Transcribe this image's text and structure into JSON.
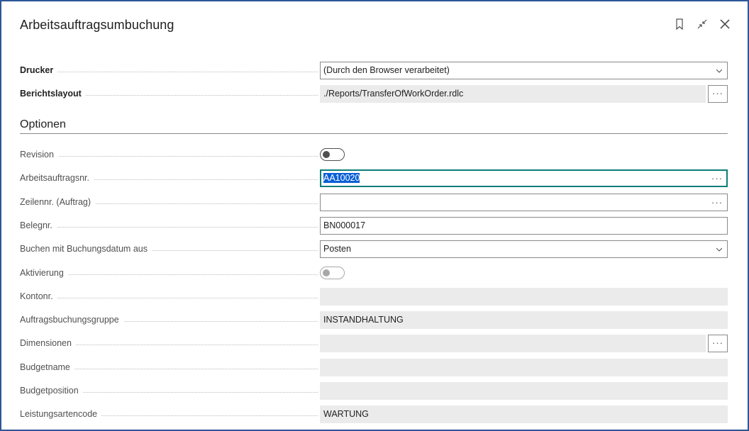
{
  "dialog": {
    "title": "Arbeitsauftragsumbuchung",
    "icons": [
      "bookmark-icon",
      "collapse-icon",
      "close-icon"
    ]
  },
  "printer": {
    "label": "Drucker",
    "value": "(Durch den Browser verarbeitet)"
  },
  "report_layout": {
    "label": "Berichtslayout",
    "value": "./Reports/TransferOfWorkOrder.rdlc",
    "button": "···"
  },
  "options": {
    "heading": "Optionen",
    "revision": {
      "label": "Revision",
      "checked": false
    },
    "work_order_no": {
      "label": "Arbeitsauftragsnr.",
      "value": "AA10020",
      "button": "···"
    },
    "line_no": {
      "label": "Zeilennr. (Auftrag)",
      "value": "",
      "button": "···"
    },
    "document_no": {
      "label": "Belegnr.",
      "value": "BN000017"
    },
    "posting_date_from": {
      "label": "Buchen mit Buchungsdatum aus",
      "value": "Posten"
    },
    "activation": {
      "label": "Aktivierung",
      "checked": false,
      "disabled": true
    },
    "account_no": {
      "label": "Kontonr.",
      "value": ""
    },
    "order_posting_group": {
      "label": "Auftragsbuchungsgruppe",
      "value": "INSTANDHALTUNG"
    },
    "dimensions": {
      "label": "Dimensionen",
      "value": "",
      "button": "···"
    },
    "budget_name": {
      "label": "Budgetname",
      "value": ""
    },
    "budget_position": {
      "label": "Budgetposition",
      "value": ""
    },
    "service_type_code": {
      "label": "Leistungsartencode",
      "value": "WARTUNG"
    }
  },
  "colors": {
    "frame_border": "#2b5797",
    "focus_border": "#0a7e79",
    "selection": "#0a5fd6",
    "readonly_bg": "#ebebeb"
  }
}
